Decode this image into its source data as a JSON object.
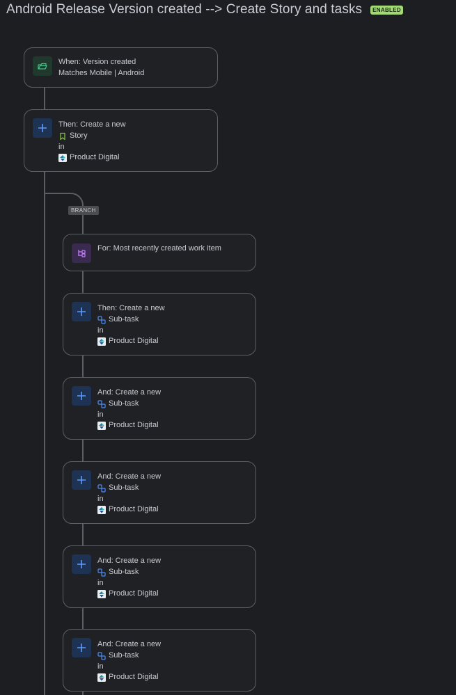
{
  "header": {
    "title": "Android Release Version created --> Create Story and tasks",
    "badge": "ENABLED"
  },
  "trigger": {
    "line1": "When: Version created",
    "line2": "Matches Mobile | Android",
    "icon": "trigger-icon"
  },
  "story_action": {
    "line1": "Then: Create a new",
    "issue_type": "Story",
    "in": "in",
    "project": "Product Digital",
    "icon": "plus-icon"
  },
  "branch": {
    "label": "BRANCH",
    "for": {
      "line1": "For: Most recently created work item",
      "icon": "branch-icon"
    },
    "actions": [
      {
        "line1": "Then: Create a new",
        "issue_type": "Sub-task",
        "in": "in",
        "project": "Product Digital"
      },
      {
        "line1": "And: Create a new",
        "issue_type": "Sub-task",
        "in": "in",
        "project": "Product Digital"
      },
      {
        "line1": "And: Create a new",
        "issue_type": "Sub-task",
        "in": "in",
        "project": "Product Digital"
      },
      {
        "line1": "And: Create a new",
        "issue_type": "Sub-task",
        "in": "in",
        "project": "Product Digital"
      },
      {
        "line1": "And: Create a new",
        "issue_type": "Sub-task",
        "in": "in",
        "project": "Product Digital"
      }
    ]
  },
  "colors": {
    "badge": "#a3d977",
    "story_icon": "#7fc241",
    "subtask_icon": "#4f8cf7",
    "plus_icon": "#5b9bff",
    "branch_icon": "#c47dff",
    "trigger_icon": "#47c28a"
  }
}
